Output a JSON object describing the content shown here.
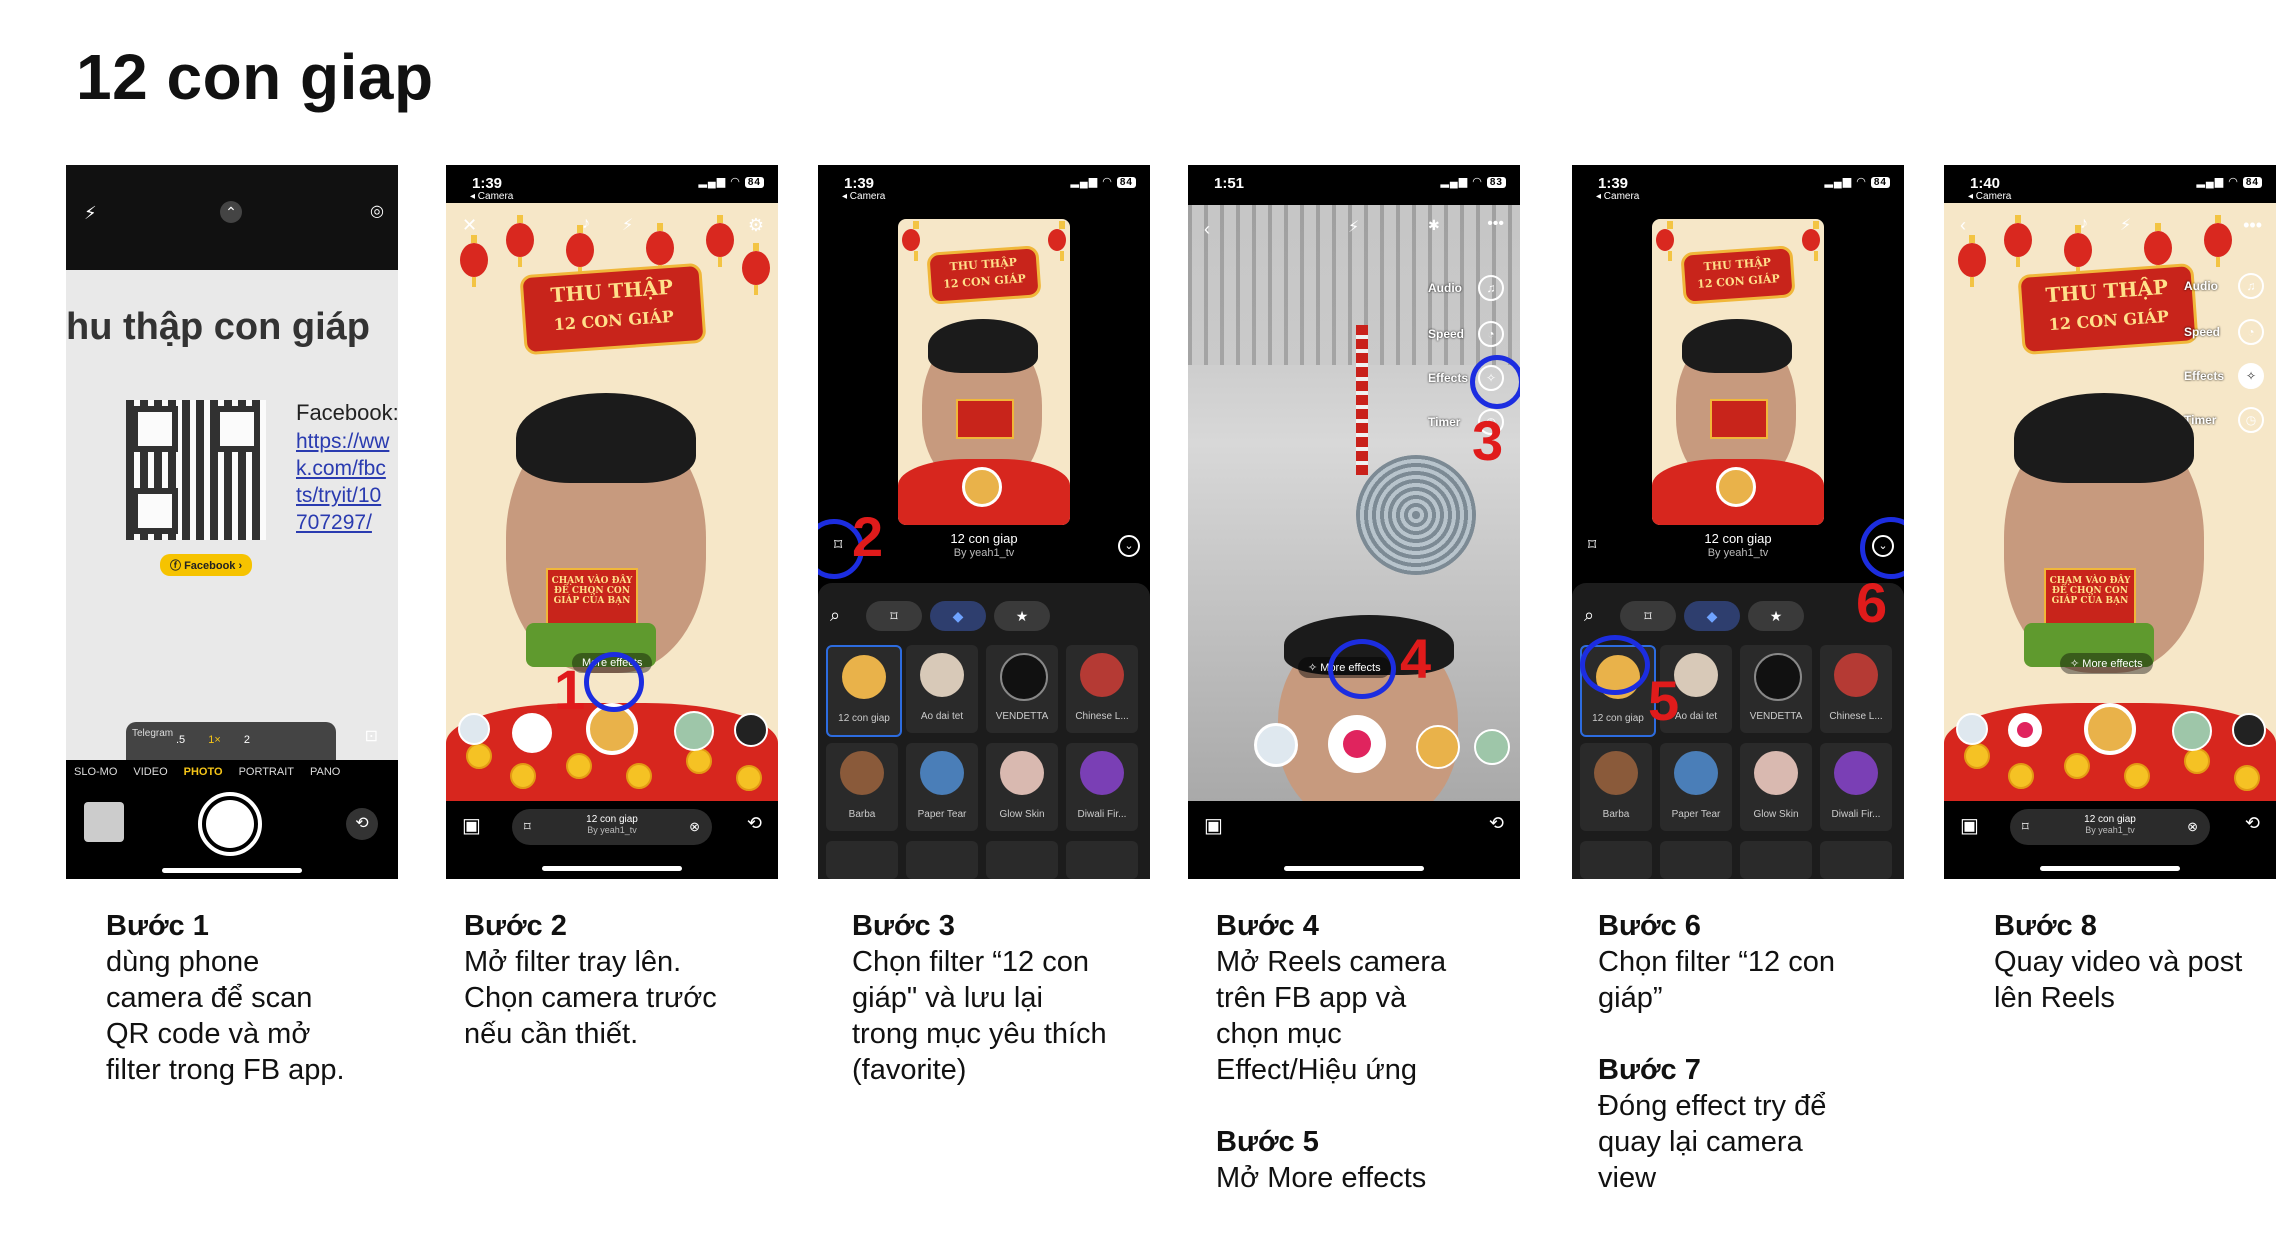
{
  "title": "12 con giap",
  "screens": {
    "s1": {
      "headline": "hu thập con giáp",
      "facebook_label": "Facebook:",
      "link_lines": [
        "https://ww",
        "k.com/fbc",
        "ts/tryit/10",
        "707297/"
      ],
      "fb_badge": "Facebook",
      "zoom": [
        ".5",
        "1×",
        "2"
      ],
      "modes": [
        "SLO-MO",
        "VIDEO",
        "PHOTO",
        "PORTRAIT",
        "PANO"
      ],
      "notification": "Telegram"
    },
    "s2": {
      "time": "1:39",
      "back": "◂ Camera",
      "battery": "84",
      "banner_line1": "THU THẬP",
      "banner_line2": "12 CON GIÁP",
      "sign": "CHẠM VÀO ĐÂY ĐỂ CHỌN CON GIÁP CỦA BẠN",
      "more_effects": "More effects",
      "pill_title": "12 con giap",
      "pill_sub": "By yeah1_tv"
    },
    "s3": {
      "time": "1:39",
      "back": "◂ Camera",
      "battery": "84",
      "banner_line1": "THU THẬP",
      "banner_line2": "12 CON GIÁP",
      "filter_name": "12 con giap",
      "filter_by": "By yeah1_tv",
      "tiles": [
        "12 con giap",
        "Ao dai tet",
        "VENDETTA",
        "Chinese L...",
        "Barba",
        "Paper Tear",
        "Glow Skin",
        "Diwali Fir..."
      ]
    },
    "s4": {
      "time": "1:51",
      "battery": "83",
      "side": [
        "Audio",
        "Speed",
        "Effects",
        "Timer"
      ],
      "more_effects": "More effects"
    },
    "s6": {
      "time": "1:39",
      "back": "◂ Camera",
      "battery": "84",
      "banner_line1": "THU THẬP",
      "banner_line2": "12 CON GIÁP",
      "filter_name": "12 con giap",
      "filter_by": "By yeah1_tv",
      "tiles": [
        "12 con giap",
        "Ao dai tet",
        "VENDETTA",
        "Chinese L...",
        "Barba",
        "Paper Tear",
        "Glow Skin",
        "Diwali Fir..."
      ]
    },
    "s8": {
      "time": "1:40",
      "back": "◂ Camera",
      "battery": "84",
      "banner_line1": "THU THẬP",
      "banner_line2": "12 CON GIÁP",
      "side": [
        "Audio",
        "Speed",
        "Effects",
        "Timer"
      ],
      "sign": "CHẠM VÀO ĐÂY ĐỂ CHỌN CON GIÁP CỦA BẠN",
      "more_effects": "More effects",
      "pill_title": "12 con giap",
      "pill_sub": "By yeah1_tv"
    }
  },
  "markers": [
    "1",
    "2",
    "3",
    "4",
    "5",
    "6"
  ],
  "captions": {
    "c1": {
      "heading": "Bước 1",
      "body": "dùng phone\ncamera để scan\nQR code và mở\nfilter trong FB app."
    },
    "c2": {
      "heading": "Bước 2",
      "body": "Mở filter tray lên.\nChọn camera trước\nnếu cần thiết."
    },
    "c3": {
      "heading": "Bước 3",
      "body": "Chọn filter “12 con\ngiáp\" và lưu lại\ntrong mục yêu thích\n(favorite)"
    },
    "c4": {
      "heading": "Bước 4",
      "body": "Mở Reels camera\ntrên FB app và\nchọn mục\nEffect/Hiệu ứng"
    },
    "c5": {
      "heading": "Bước 5",
      "body": "Mở More effects"
    },
    "c6": {
      "heading": "Bước 6",
      "body": "Chọn filter “12 con\ngiáp”"
    },
    "c7": {
      "heading": "Bước 7",
      "body": "Đóng effect try để\nquay lại camera\nview"
    },
    "c8": {
      "heading": "Bước 8",
      "body": "Quay video và post\nlên Reels"
    }
  },
  "colors": {
    "marker": "#e01b1b",
    "ring": "#1c2de0",
    "filter_red": "#c8241b",
    "filter_bg": "#f6e7c8"
  }
}
